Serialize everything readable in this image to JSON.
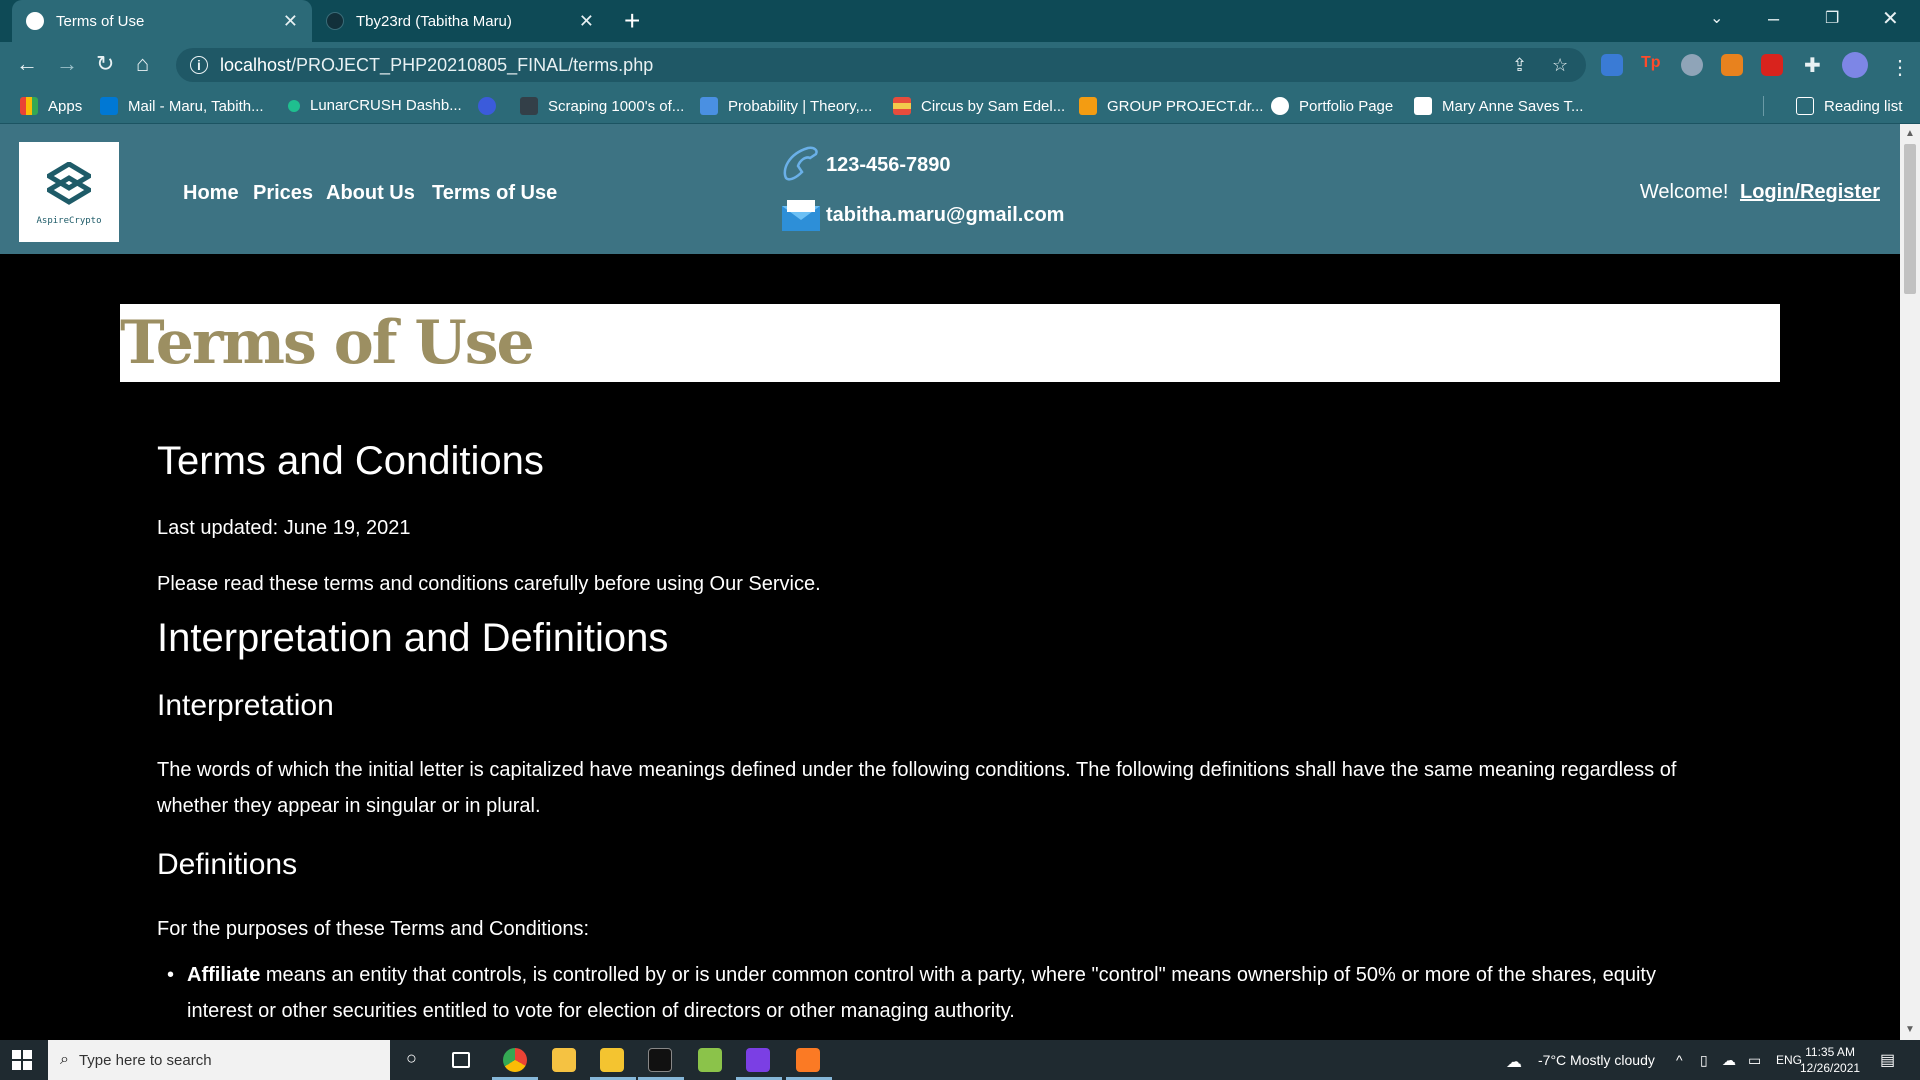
{
  "browser": {
    "tabs": [
      {
        "title": "Terms of Use",
        "active": true
      },
      {
        "title": "Tby23rd (Tabitha Maru)",
        "active": false
      }
    ],
    "new_tab": "+",
    "url_host": "localhost",
    "url_path": "/PROJECT_PHP20210805_FINAL/terms.php",
    "bookmarks": [
      {
        "label": "Apps",
        "color": "#f4b400"
      },
      {
        "label": "Mail - Maru, Tabith...",
        "color": "#0078d4"
      },
      {
        "label": "LunarCRUSH Dashb...",
        "color": "#1fbf8f"
      },
      {
        "label": "",
        "color": "#3b5bdb"
      },
      {
        "label": "Scraping 1000's of...",
        "color": "#333f48"
      },
      {
        "label": "Probability | Theory,...",
        "color": "#4a90e2"
      },
      {
        "label": "Circus by Sam Edel...",
        "color": "#f2c94c"
      },
      {
        "label": "GROUP PROJECT.dr...",
        "color": "#f39c12"
      },
      {
        "label": "Portfolio Page",
        "color": "#ffffff"
      },
      {
        "label": "Mary Anne Saves T...",
        "color": "#ffffff"
      }
    ],
    "reading_list": "Reading list"
  },
  "site": {
    "logo_name": "AspireCrypto",
    "nav": [
      "Home",
      "Prices",
      "About Us",
      "Terms of Use"
    ],
    "phone": "123-456-7890",
    "email": "tabitha.maru@gmail.com",
    "welcome": "Welcome!",
    "login": "Login/Register",
    "page_title": "Terms of Use"
  },
  "content": {
    "h_terms": "Terms and Conditions",
    "last_updated": "Last updated: June 19, 2021",
    "intro": "Please read these terms and conditions carefully before using Our Service.",
    "h_interp_defs": "Interpretation and Definitions",
    "h_interp": "Interpretation",
    "interp_text": "The words of which the initial letter is capitalized have meanings defined under the following conditions. The following definitions shall have the same meaning regardless of whether they appear in singular or in plural.",
    "h_defs": "Definitions",
    "defs_intro": "For the purposes of these Terms and Conditions:",
    "affiliate_term": "Affiliate",
    "affiliate_text": " means an entity that controls, is controlled by or is under common control with a party, where \"control\" means ownership of 50% or more of the shares, equity interest or other securities entitled to vote for election of directors or other managing authority."
  },
  "taskbar": {
    "search_placeholder": "Type here to search",
    "weather": "-7°C  Mostly cloudy",
    "lang": "ENG",
    "time": "11:35 AM",
    "date": "12/26/2021"
  }
}
